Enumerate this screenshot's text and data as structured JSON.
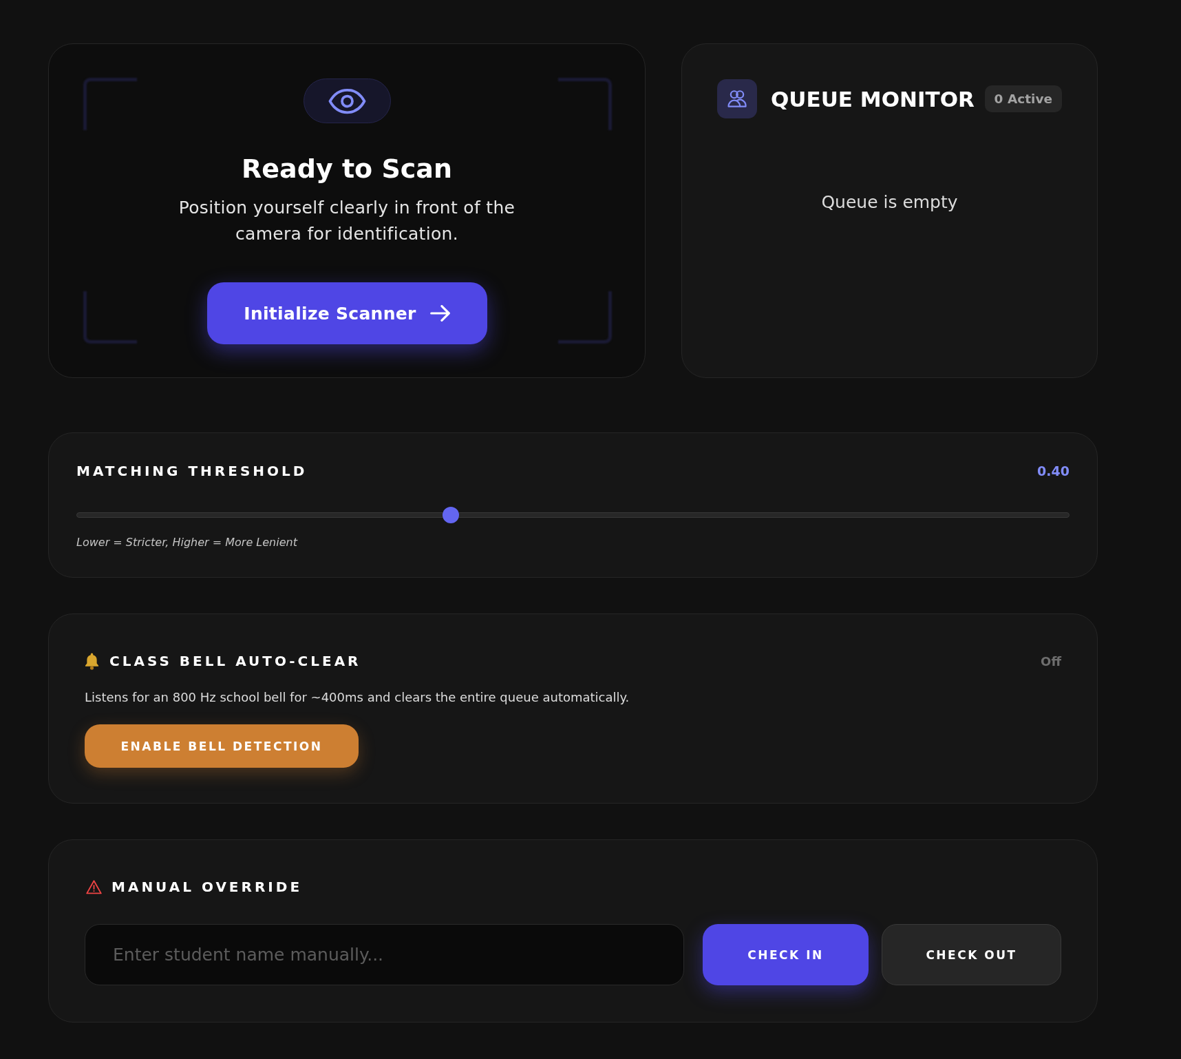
{
  "scanner": {
    "title": "Ready to Scan",
    "description": "Position yourself clearly in front of the camera for identification.",
    "button": {
      "label": "Initialize Scanner"
    }
  },
  "queue": {
    "title": "QUEUE MONITOR",
    "badge": "0 Active",
    "empty_message": "Queue is empty"
  },
  "threshold": {
    "title": "MATCHING THRESHOLD",
    "reading": "0.40",
    "level": 0.375,
    "hint": "Lower = Stricter, Higher = More Lenient"
  },
  "bell": {
    "title": "CLASS BELL AUTO-CLEAR",
    "status": "Off",
    "on": false,
    "description": "Listens for an 800 Hz school bell for ~400ms and clears the entire queue automatically.",
    "button": {
      "label": "ENABLE BELL DETECTION"
    }
  },
  "manual_override": {
    "title": "MANUAL OVERRIDE",
    "input": {
      "placeholder": "Enter student name manually..."
    },
    "buttons": [
      {
        "label": "CHECK IN",
        "kind": "primary"
      },
      {
        "label": "CHECK OUT",
        "kind": "secondary"
      }
    ]
  }
}
